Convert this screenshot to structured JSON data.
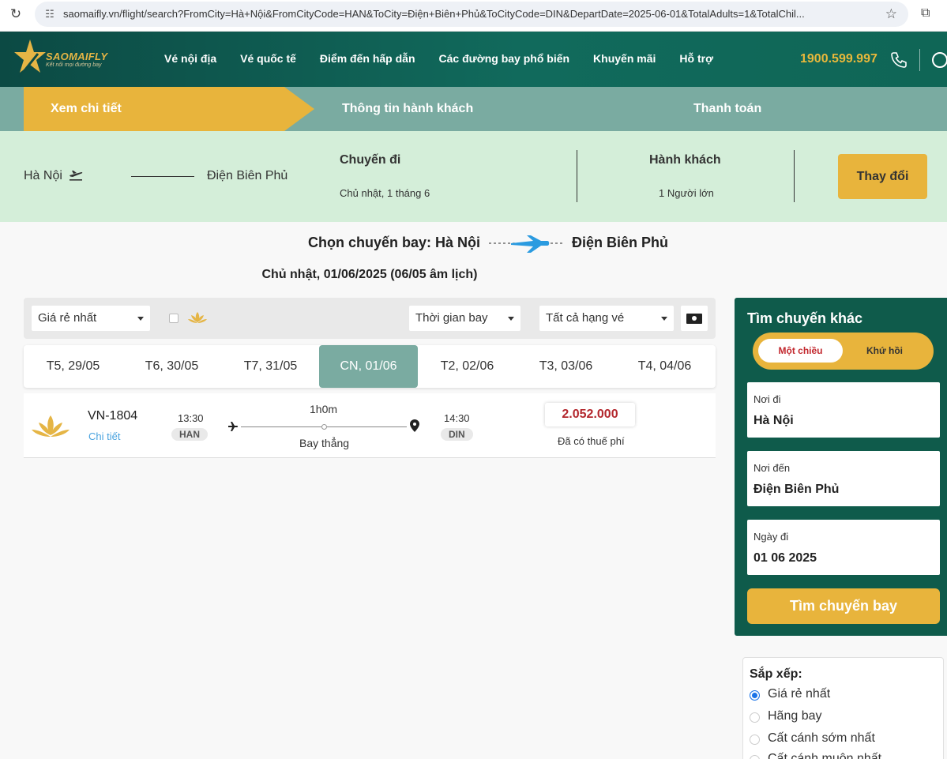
{
  "browser": {
    "url": "saomaifly.vn/flight/search?FromCity=Hà+Nội&FromCityCode=HAN&ToCity=Điện+Biên+Phủ&ToCityCode=DIN&DepartDate=2025-06-01&TotalAdults=1&TotalChil..."
  },
  "header": {
    "brand": "SAOMAIFLY",
    "slogan": "Kết nối mọi đường bay",
    "nav": [
      "Vé nội địa",
      "Vé quốc tế",
      "Điểm đến hấp dẫn",
      "Các đường bay phổ biến",
      "Khuyến mãi",
      "Hỗ trợ"
    ],
    "hotline": "1900.599.997"
  },
  "steps": [
    "Xem chi tiết",
    "Thông tin hành khách",
    "Thanh toán"
  ],
  "summary": {
    "from": "Hà Nội",
    "to": "Điện Biên Phủ",
    "trip_title": "Chuyến đi",
    "trip_date": "Chủ nhật, 1 tháng 6",
    "pax_title": "Hành khách",
    "pax_value": "1 Người lớn",
    "change_button": "Thay đổi"
  },
  "heading": {
    "prefix": "Chọn chuyến bay: Hà Nội",
    "dest": "Điện Biên Phủ",
    "date": "Chủ nhật, 01/06/2025 (06/05 âm lịch)"
  },
  "filters": {
    "sort_select": "Giá rẻ nhất",
    "time_select": "Thời gian bay",
    "class_select": "Tất cả hạng vé"
  },
  "date_tabs": [
    "T5, 29/05",
    "T6, 30/05",
    "T7, 31/05",
    "CN, 01/06",
    "T2, 02/06",
    "T3, 03/06",
    "T4, 04/06"
  ],
  "active_date_index": 3,
  "flight": {
    "code": "VN-1804",
    "detail_link": "Chi tiết",
    "depart_time": "13:30",
    "depart_code": "HAN",
    "duration": "1h0m",
    "stop_type": "Bay thẳng",
    "arrive_time": "14:30",
    "arrive_code": "DIN",
    "price": "2.052.000",
    "tax_note": "Đã có thuế phí"
  },
  "side_search": {
    "title": "Tìm chuyến khác",
    "one_way": "Một chiều",
    "round_trip": "Khứ hồi",
    "from_label": "Nơi đi",
    "from_value": "Hà Nội",
    "to_label": "Nơi đến",
    "to_value": "Điện Biên Phủ",
    "date_label": "Ngày đi",
    "date_value": "01 06 2025",
    "search_button": "Tìm chuyến bay"
  },
  "sort": {
    "title": "Sắp xếp:",
    "options": [
      "Giá rẻ nhất",
      "Hãng bay",
      "Cất cánh sớm nhất",
      "Cất cánh muộn nhất"
    ],
    "selected_index": 0
  },
  "colors": {
    "header_green": "#116a5c",
    "gold": "#e8b43c",
    "teal_tab": "#7aaba1",
    "summary_bg": "#d4eed9",
    "price_red": "#b3272d"
  }
}
